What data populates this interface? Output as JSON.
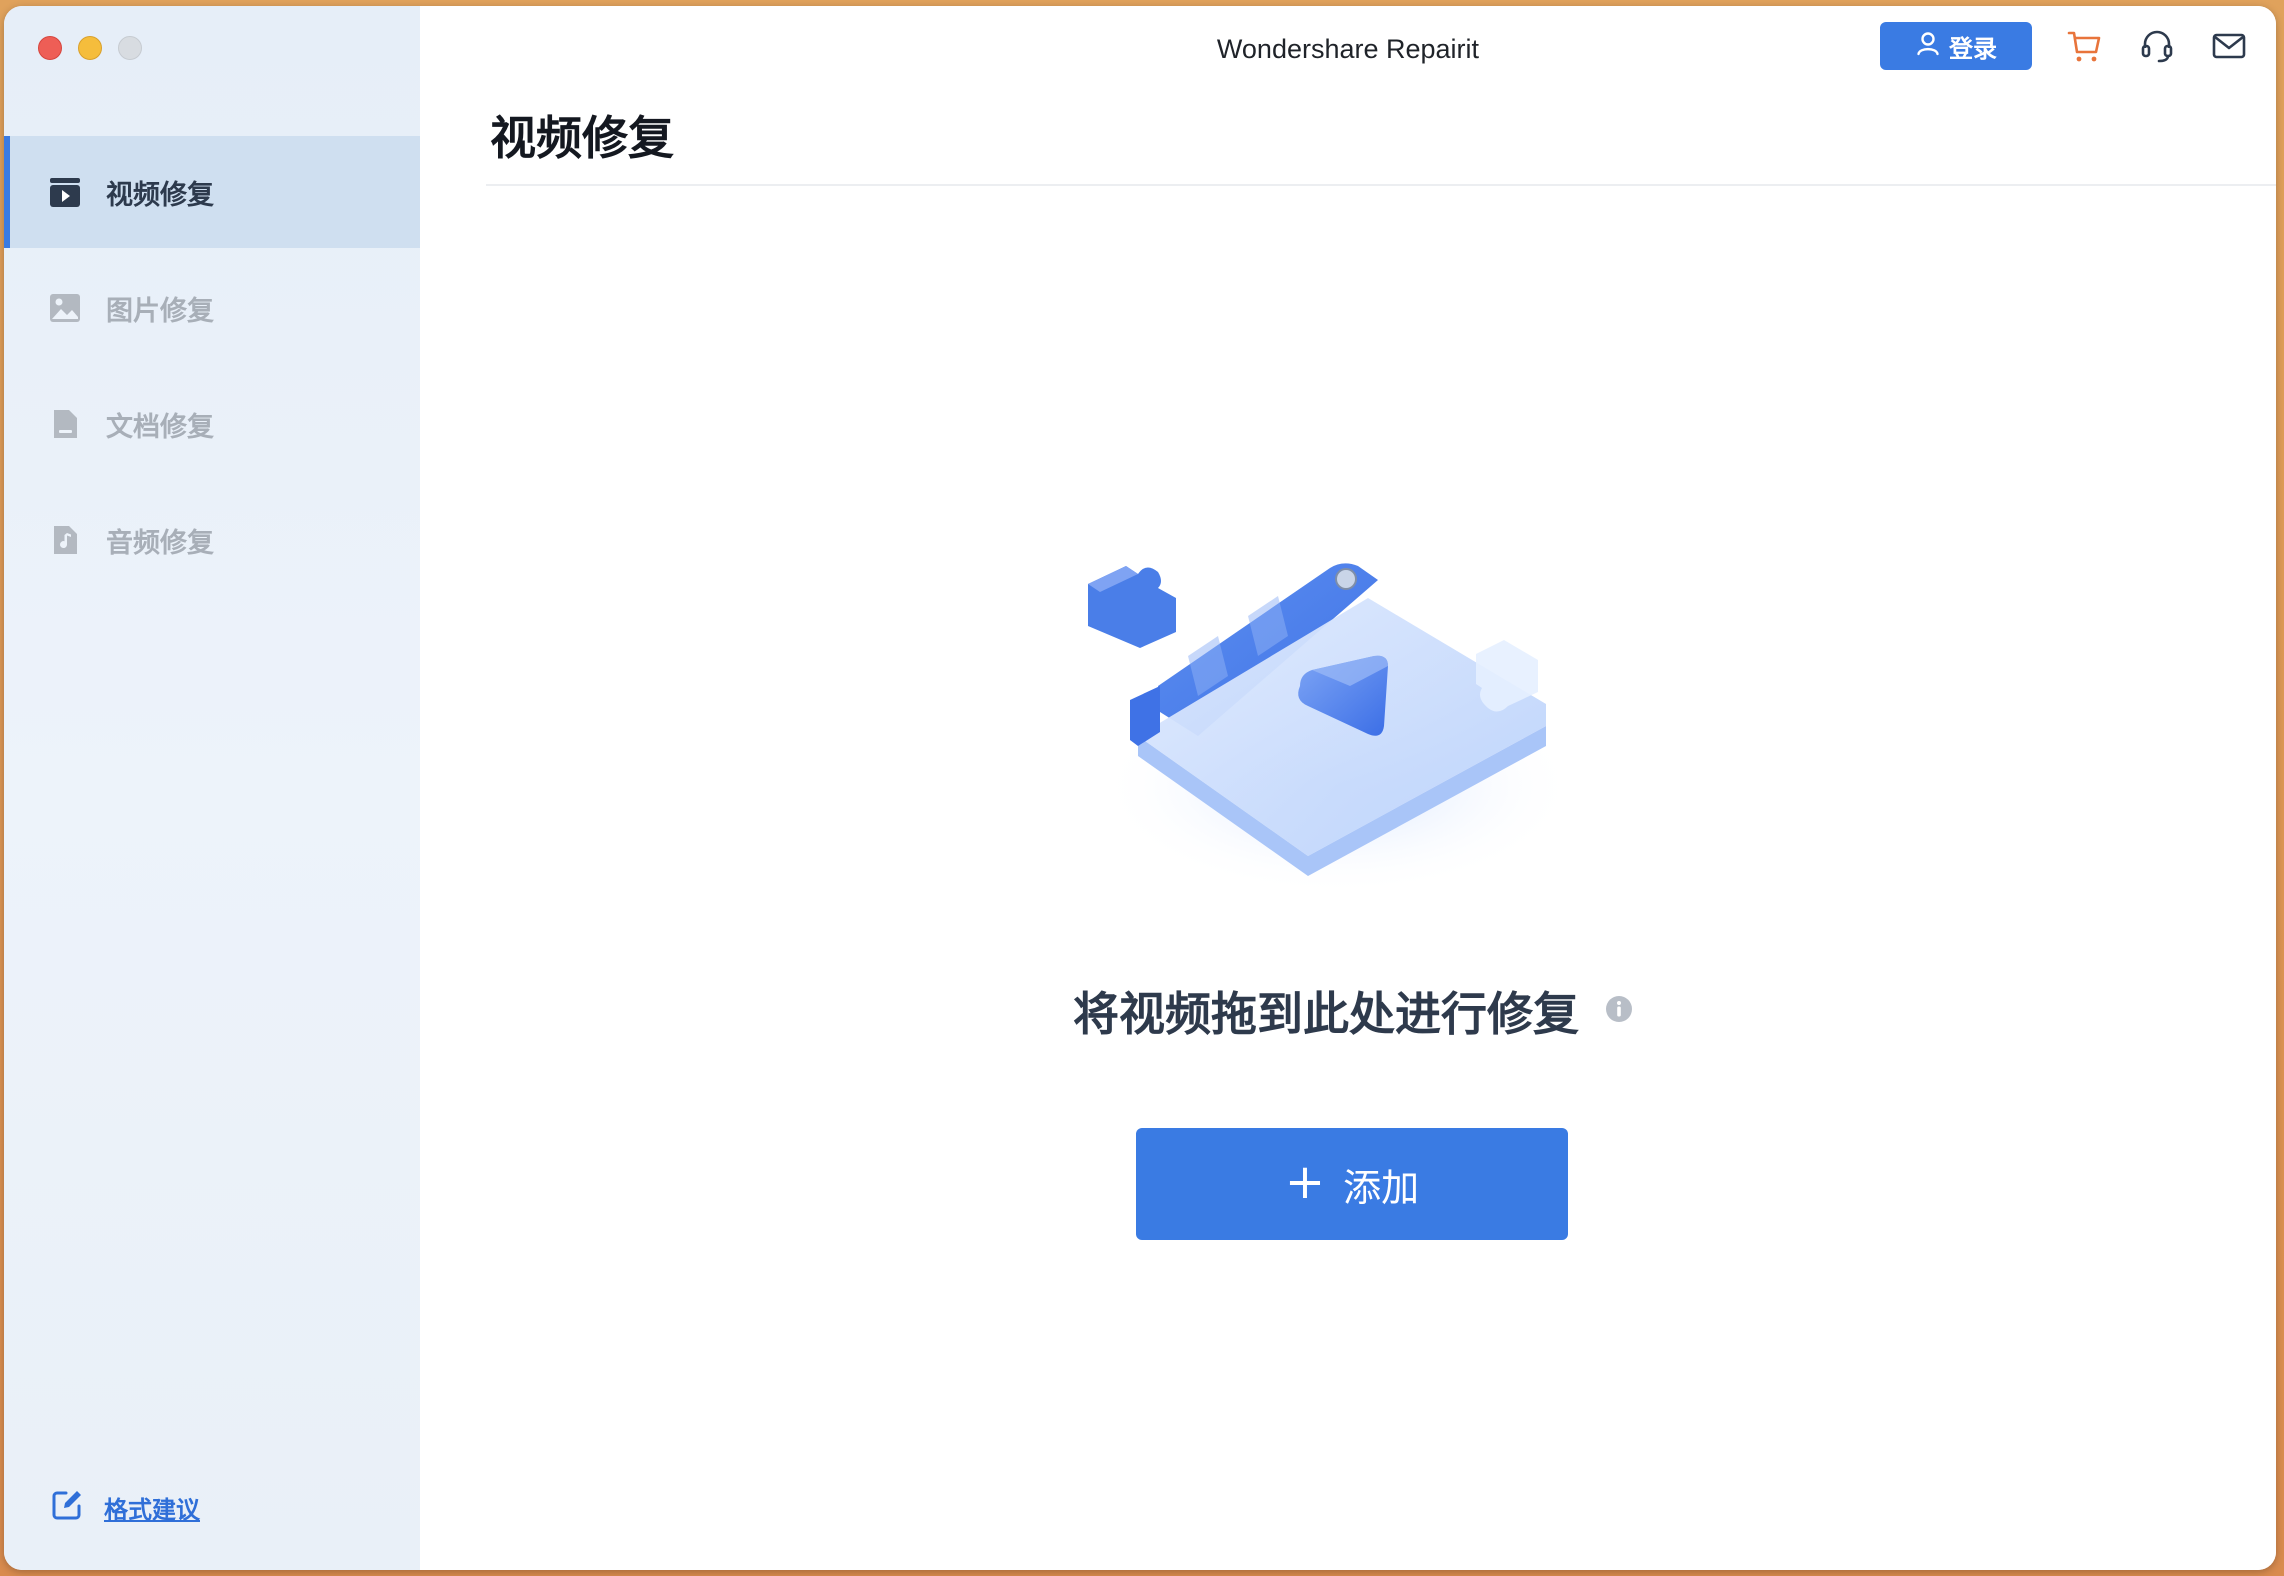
{
  "window": {
    "title": "Wondershare Repairit"
  },
  "sidebar": {
    "items": [
      {
        "label": "视频修复",
        "icon": "video-icon",
        "active": true
      },
      {
        "label": "图片修复",
        "icon": "image-icon",
        "active": false
      },
      {
        "label": "文档修复",
        "icon": "document-icon",
        "active": false
      },
      {
        "label": "音频修复",
        "icon": "audio-icon",
        "active": false
      }
    ],
    "feedback_label": "格式建议"
  },
  "toolbar": {
    "login_label": "登录"
  },
  "main": {
    "page_title": "视频修复",
    "drop_text": "将视频拖到此处进行修复",
    "add_label": "添加",
    "add_symbol": "+"
  },
  "colors": {
    "accent": "#3a7be3",
    "cart": "#e8743b",
    "active_nav_bg": "#cfdff0"
  }
}
